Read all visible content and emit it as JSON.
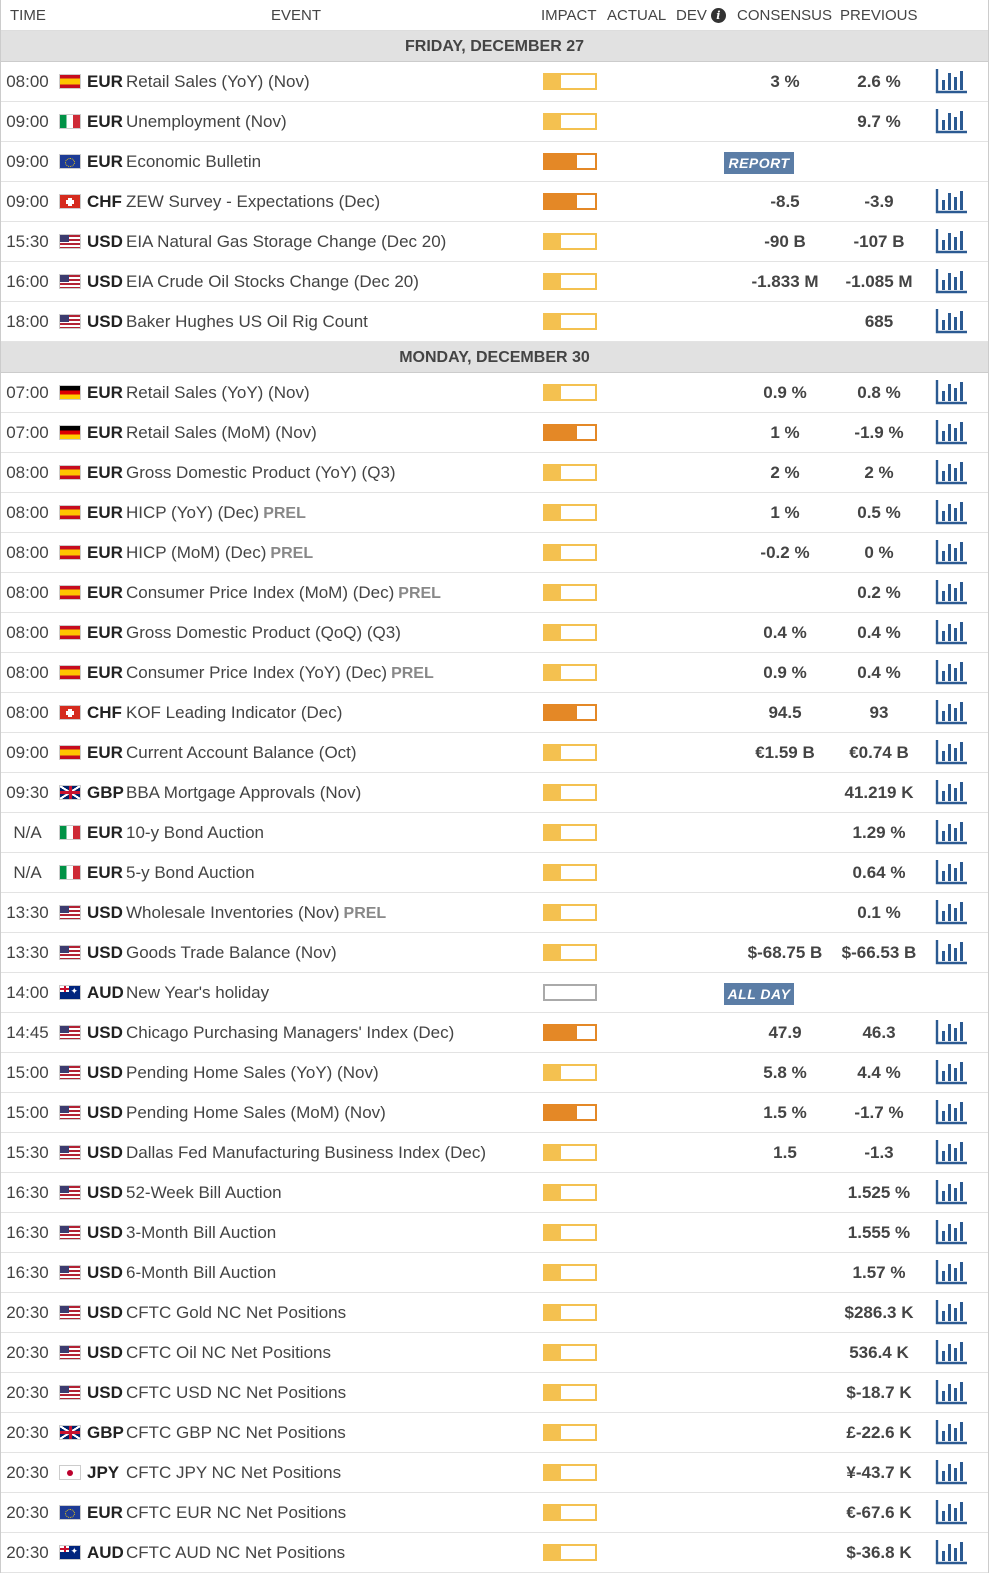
{
  "header": {
    "time": "TIME",
    "event": "EVENT",
    "impact": "IMPACT",
    "actual": "ACTUAL",
    "dev": "DEV",
    "consensus": "CONSENSUS",
    "previous": "PREVIOUS",
    "info_icon": "i"
  },
  "days": [
    {
      "label": "FRIDAY, DECEMBER 27",
      "events": [
        {
          "time": "08:00",
          "flag": "es",
          "cur": "EUR",
          "name": "Retail Sales (YoY) (Nov)",
          "prel": "",
          "impact": "low",
          "consensus": "3 %",
          "previous": "2.6 %",
          "tag": "",
          "chart": true
        },
        {
          "time": "09:00",
          "flag": "it",
          "cur": "EUR",
          "name": "Unemployment (Nov)",
          "prel": "",
          "impact": "low",
          "consensus": "",
          "previous": "9.7 %",
          "tag": "",
          "chart": true
        },
        {
          "time": "09:00",
          "flag": "eu",
          "cur": "EUR",
          "name": "Economic Bulletin",
          "prel": "",
          "impact": "med",
          "consensus": "",
          "previous": "",
          "tag": "REPORT",
          "chart": false
        },
        {
          "time": "09:00",
          "flag": "ch",
          "cur": "CHF",
          "name": "ZEW Survey - Expectations (Dec)",
          "prel": "",
          "impact": "med",
          "consensus": "-8.5",
          "previous": "-3.9",
          "tag": "",
          "chart": true
        },
        {
          "time": "15:30",
          "flag": "us",
          "cur": "USD",
          "name": "EIA Natural Gas Storage Change (Dec 20)",
          "prel": "",
          "impact": "low",
          "consensus": "-90 B",
          "previous": "-107 B",
          "tag": "",
          "chart": true
        },
        {
          "time": "16:00",
          "flag": "us",
          "cur": "USD",
          "name": "EIA Crude Oil Stocks Change (Dec 20)",
          "prel": "",
          "impact": "low",
          "consensus": "-1.833 M",
          "previous": "-1.085 M",
          "tag": "",
          "chart": true
        },
        {
          "time": "18:00",
          "flag": "us",
          "cur": "USD",
          "name": "Baker Hughes US Oil Rig Count",
          "prel": "",
          "impact": "low",
          "consensus": "",
          "previous": "685",
          "tag": "",
          "chart": true
        }
      ]
    },
    {
      "label": "MONDAY, DECEMBER 30",
      "events": [
        {
          "time": "07:00",
          "flag": "de",
          "cur": "EUR",
          "name": "Retail Sales (YoY) (Nov)",
          "prel": "",
          "impact": "low",
          "consensus": "0.9 %",
          "previous": "0.8 %",
          "tag": "",
          "chart": true
        },
        {
          "time": "07:00",
          "flag": "de",
          "cur": "EUR",
          "name": "Retail Sales (MoM) (Nov)",
          "prel": "",
          "impact": "med",
          "consensus": "1 %",
          "previous": "-1.9 %",
          "tag": "",
          "chart": true
        },
        {
          "time": "08:00",
          "flag": "es",
          "cur": "EUR",
          "name": "Gross Domestic Product (YoY) (Q3)",
          "prel": "",
          "impact": "low",
          "consensus": "2 %",
          "previous": "2 %",
          "tag": "",
          "chart": true
        },
        {
          "time": "08:00",
          "flag": "es",
          "cur": "EUR",
          "name": "HICP (YoY) (Dec)",
          "prel": "PREL",
          "impact": "low",
          "consensus": "1 %",
          "previous": "0.5 %",
          "tag": "",
          "chart": true
        },
        {
          "time": "08:00",
          "flag": "es",
          "cur": "EUR",
          "name": "HICP (MoM) (Dec)",
          "prel": "PREL",
          "impact": "low",
          "consensus": "-0.2 %",
          "previous": "0 %",
          "tag": "",
          "chart": true
        },
        {
          "time": "08:00",
          "flag": "es",
          "cur": "EUR",
          "name": "Consumer Price Index (MoM) (Dec)",
          "prel": "PREL",
          "impact": "low",
          "consensus": "",
          "previous": "0.2 %",
          "tag": "",
          "chart": true
        },
        {
          "time": "08:00",
          "flag": "es",
          "cur": "EUR",
          "name": "Gross Domestic Product (QoQ) (Q3)",
          "prel": "",
          "impact": "low",
          "consensus": "0.4 %",
          "previous": "0.4 %",
          "tag": "",
          "chart": true
        },
        {
          "time": "08:00",
          "flag": "es",
          "cur": "EUR",
          "name": "Consumer Price Index (YoY) (Dec)",
          "prel": "PREL",
          "impact": "low",
          "consensus": "0.9 %",
          "previous": "0.4 %",
          "tag": "",
          "chart": true
        },
        {
          "time": "08:00",
          "flag": "ch",
          "cur": "CHF",
          "name": "KOF Leading Indicator (Dec)",
          "prel": "",
          "impact": "med",
          "consensus": "94.5",
          "previous": "93",
          "tag": "",
          "chart": true
        },
        {
          "time": "09:00",
          "flag": "es",
          "cur": "EUR",
          "name": "Current Account Balance (Oct)",
          "prel": "",
          "impact": "low",
          "consensus": "€1.59 B",
          "previous": "€0.74 B",
          "tag": "",
          "chart": true
        },
        {
          "time": "09:30",
          "flag": "gb",
          "cur": "GBP",
          "name": "BBA Mortgage Approvals (Nov)",
          "prel": "",
          "impact": "low",
          "consensus": "",
          "previous": "41.219 K",
          "tag": "",
          "chart": true
        },
        {
          "time": "N/A",
          "flag": "it",
          "cur": "EUR",
          "name": "10-y Bond Auction",
          "prel": "",
          "impact": "low",
          "consensus": "",
          "previous": "1.29 %",
          "tag": "",
          "chart": true
        },
        {
          "time": "N/A",
          "flag": "it",
          "cur": "EUR",
          "name": "5-y Bond Auction",
          "prel": "",
          "impact": "low",
          "consensus": "",
          "previous": "0.64 %",
          "tag": "",
          "chart": true
        },
        {
          "time": "13:30",
          "flag": "us",
          "cur": "USD",
          "name": "Wholesale Inventories (Nov)",
          "prel": "PREL",
          "impact": "low",
          "consensus": "",
          "previous": "0.1 %",
          "tag": "",
          "chart": true
        },
        {
          "time": "13:30",
          "flag": "us",
          "cur": "USD",
          "name": "Goods Trade Balance (Nov)",
          "prel": "",
          "impact": "low",
          "consensus": "$-68.75 B",
          "previous": "$-66.53 B",
          "tag": "",
          "chart": true
        },
        {
          "time": "14:00",
          "flag": "au",
          "cur": "AUD",
          "name": "New Year's holiday",
          "prel": "",
          "impact": "none",
          "consensus": "",
          "previous": "",
          "tag": "ALL DAY",
          "chart": false
        },
        {
          "time": "14:45",
          "flag": "us",
          "cur": "USD",
          "name": "Chicago Purchasing Managers' Index (Dec)",
          "prel": "",
          "impact": "med",
          "consensus": "47.9",
          "previous": "46.3",
          "tag": "",
          "chart": true
        },
        {
          "time": "15:00",
          "flag": "us",
          "cur": "USD",
          "name": "Pending Home Sales (YoY) (Nov)",
          "prel": "",
          "impact": "low",
          "consensus": "5.8 %",
          "previous": "4.4 %",
          "tag": "",
          "chart": true
        },
        {
          "time": "15:00",
          "flag": "us",
          "cur": "USD",
          "name": "Pending Home Sales (MoM) (Nov)",
          "prel": "",
          "impact": "med",
          "consensus": "1.5 %",
          "previous": "-1.7 %",
          "tag": "",
          "chart": true
        },
        {
          "time": "15:30",
          "flag": "us",
          "cur": "USD",
          "name": "Dallas Fed Manufacturing Business Index (Dec)",
          "prel": "",
          "impact": "low",
          "consensus": "1.5",
          "previous": "-1.3",
          "tag": "",
          "chart": true
        },
        {
          "time": "16:30",
          "flag": "us",
          "cur": "USD",
          "name": "52-Week Bill Auction",
          "prel": "",
          "impact": "low",
          "consensus": "",
          "previous": "1.525 %",
          "tag": "",
          "chart": true
        },
        {
          "time": "16:30",
          "flag": "us",
          "cur": "USD",
          "name": "3-Month Bill Auction",
          "prel": "",
          "impact": "low",
          "consensus": "",
          "previous": "1.555 %",
          "tag": "",
          "chart": true
        },
        {
          "time": "16:30",
          "flag": "us",
          "cur": "USD",
          "name": "6-Month Bill Auction",
          "prel": "",
          "impact": "low",
          "consensus": "",
          "previous": "1.57 %",
          "tag": "",
          "chart": true
        },
        {
          "time": "20:30",
          "flag": "us",
          "cur": "USD",
          "name": "CFTC Gold NC Net Positions",
          "prel": "",
          "impact": "low",
          "consensus": "",
          "previous": "$286.3 K",
          "tag": "",
          "chart": true
        },
        {
          "time": "20:30",
          "flag": "us",
          "cur": "USD",
          "name": "CFTC Oil NC Net Positions",
          "prel": "",
          "impact": "low",
          "consensus": "",
          "previous": "536.4 K",
          "tag": "",
          "chart": true
        },
        {
          "time": "20:30",
          "flag": "us",
          "cur": "USD",
          "name": "CFTC USD NC Net Positions",
          "prel": "",
          "impact": "low",
          "consensus": "",
          "previous": "$-18.7 K",
          "tag": "",
          "chart": true
        },
        {
          "time": "20:30",
          "flag": "gb",
          "cur": "GBP",
          "name": "CFTC GBP NC Net Positions",
          "prel": "",
          "impact": "low",
          "consensus": "",
          "previous": "£-22.6 K",
          "tag": "",
          "chart": true
        },
        {
          "time": "20:30",
          "flag": "jp",
          "cur": "JPY",
          "name": "CFTC JPY NC Net Positions",
          "prel": "",
          "impact": "low",
          "consensus": "",
          "previous": "¥-43.7 K",
          "tag": "",
          "chart": true
        },
        {
          "time": "20:30",
          "flag": "eu",
          "cur": "EUR",
          "name": "CFTC EUR NC Net Positions",
          "prel": "",
          "impact": "low",
          "consensus": "",
          "previous": "€-67.6 K",
          "tag": "",
          "chart": true
        },
        {
          "time": "20:30",
          "flag": "au",
          "cur": "AUD",
          "name": "CFTC AUD NC Net Positions",
          "prel": "",
          "impact": "low",
          "consensus": "",
          "previous": "$-36.8 K",
          "tag": "",
          "chart": true
        }
      ]
    }
  ],
  "colors": {
    "low": "#f4c150",
    "med": "#e48826",
    "chart_icon": "#2b5a92",
    "tag_bg": "#5b7da6",
    "day_bg": "#e1e1e1"
  },
  "icons": {
    "chart": "bar-chart-icon",
    "info": "info-icon"
  }
}
